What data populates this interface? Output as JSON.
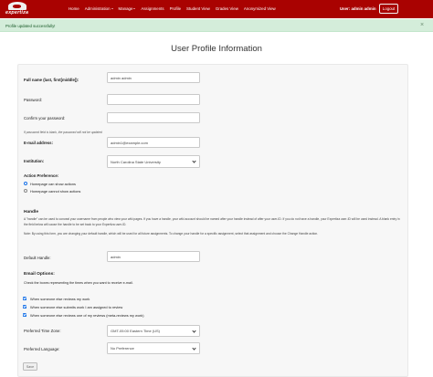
{
  "navbar": {
    "brand": "expertiza",
    "links": [
      {
        "label": "Home",
        "has_caret": false
      },
      {
        "label": "Administration",
        "has_caret": true
      },
      {
        "label": "Manage",
        "has_caret": true
      },
      {
        "label": "Assignments",
        "has_caret": false
      },
      {
        "label": "Profile",
        "has_caret": false
      },
      {
        "label": "Student View",
        "has_caret": false
      },
      {
        "label": "Grades View",
        "has_caret": false
      },
      {
        "label": "Anonymized View",
        "has_caret": false
      }
    ],
    "user_label": "User: admin admin",
    "logout_label": "Logout"
  },
  "alert": {
    "text": "Profile updated successfully!",
    "close": "×"
  },
  "page_title": "User Profile Information",
  "form": {
    "full_name": {
      "label": "Full name (last, first[middle]):",
      "value": "admin admin"
    },
    "password": {
      "label": "Password:",
      "value": ""
    },
    "confirm_password": {
      "label": "Confirm your password:",
      "value": ""
    },
    "password_hint": "If password field is blank, the password will not be updated",
    "email": {
      "label": "E-mail address:",
      "value": "admin1@example.com"
    },
    "institution": {
      "label": "Institution:",
      "value": "North Carolina State University"
    },
    "action_preference": {
      "label": "Action Preference:",
      "options": [
        {
          "label": "Homepage can show actions",
          "checked": true
        },
        {
          "label": "Homepage cannot show actions",
          "checked": false
        }
      ]
    },
    "handle": {
      "title": "Handle",
      "paragraph1": "A \"handle\" can be used to conceal your username from people who view your wiki pages. If you have a handle, your wiki account should be named after your handle instead of after your user-ID. If you do not have a handle, your Expertiza user-ID will be used instead. A blank entry in the field below will cause the handle to be set back to your Expertiza user-ID.",
      "paragraph2": "Note: By using this form, you are changing your default handle, which will be used for all future assignments. To change your handle for a specific assignment, select that assignment and choose the Change Handle action.",
      "default_label": "Default Handle:",
      "default_value": "admin"
    },
    "email_options": {
      "title": "Email Options:",
      "description": "Check the boxes representing the times when you want to receive e-mail.",
      "options": [
        {
          "label": "When someone else reviews my work",
          "checked": true
        },
        {
          "label": "When someone else submits work I am assigned to review",
          "checked": true
        },
        {
          "label": "When someone else reviews one of my reviews (meta-reviews my work)",
          "checked": true
        }
      ]
    },
    "time_zone": {
      "label": "Preferred Time Zone:",
      "value": "GMT-05:00 Eastern Time (US)"
    },
    "language": {
      "label": "Preferred Language:",
      "value": "No Preference"
    },
    "save_label": "Save"
  }
}
